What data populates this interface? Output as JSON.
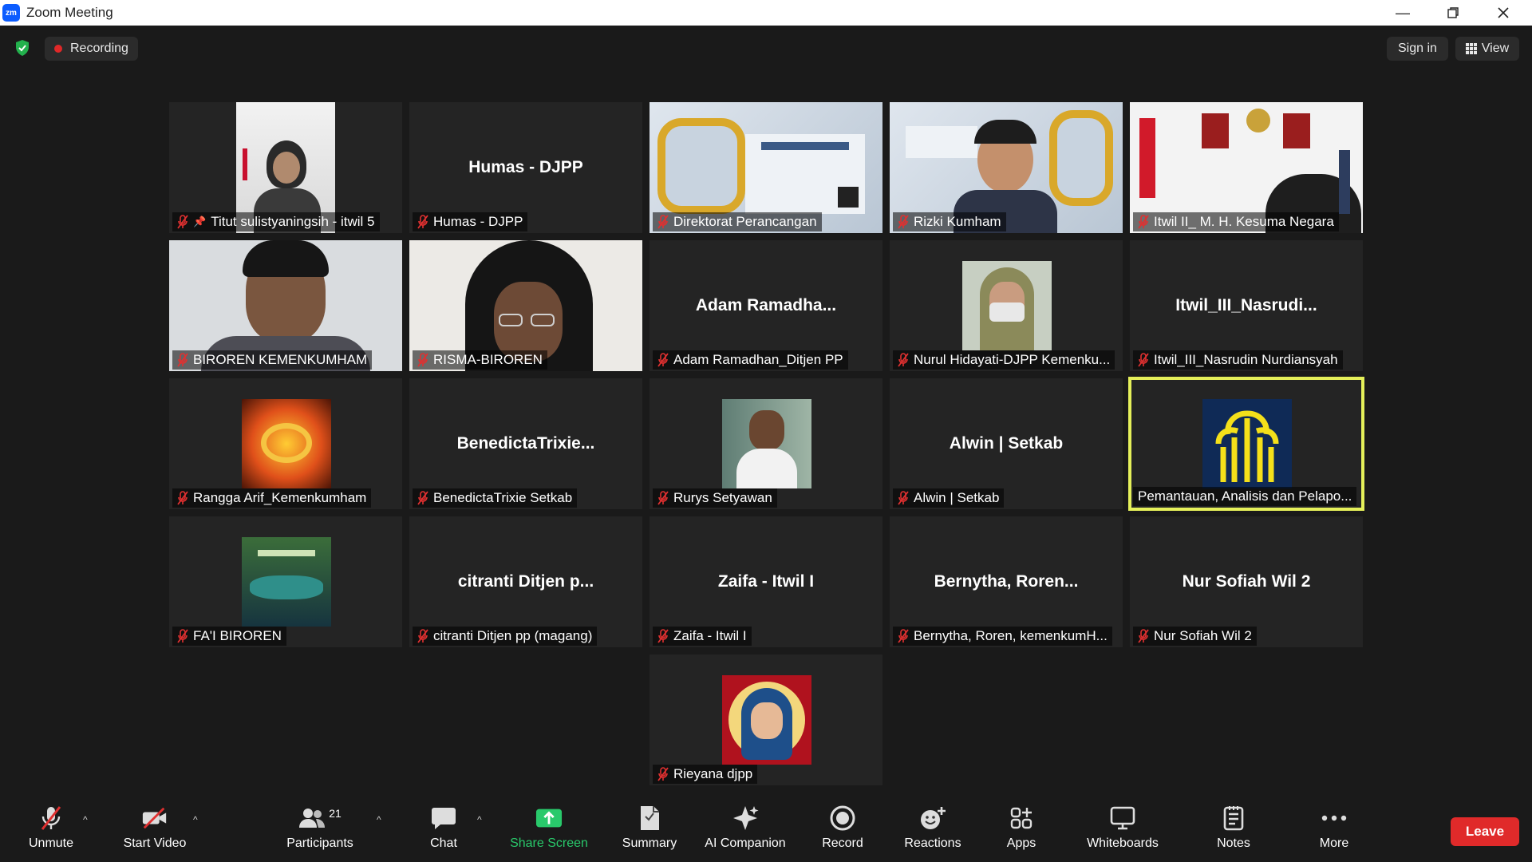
{
  "window": {
    "title": "Zoom Meeting"
  },
  "topbar": {
    "recording_label": "Recording",
    "signin_label": "Sign in",
    "view_label": "View"
  },
  "tiles": [
    {
      "name": "Titut sulistyaningsih - itwil 5",
      "bigname": "",
      "pinned": true
    },
    {
      "name": "Humas - DJPP",
      "bigname": "Humas - DJPP"
    },
    {
      "name": "Direktorat Perancangan",
      "bigname": ""
    },
    {
      "name": "Rizki Kumham",
      "bigname": ""
    },
    {
      "name": "Itwil II_ M. H. Kesuma Negara",
      "bigname": ""
    },
    {
      "name": "BIROREN KEMENKUMHAM",
      "bigname": ""
    },
    {
      "name": "RISMA-BIROREN",
      "bigname": ""
    },
    {
      "name": "Adam Ramadhan_Ditjen PP",
      "bigname": "Adam  Ramadha..."
    },
    {
      "name": "Nurul Hidayati-DJPP Kemenku...",
      "bigname": ""
    },
    {
      "name": "Itwil_III_Nasrudin Nurdiansyah",
      "bigname": "Itwil_III_Nasrudi..."
    },
    {
      "name": "Rangga Arif_Kemenkumham",
      "bigname": ""
    },
    {
      "name": "BenedictaTrixie Setkab",
      "bigname": "BenedictaTrixie..."
    },
    {
      "name": "Rurys Setyawan",
      "bigname": ""
    },
    {
      "name": "Alwin | Setkab",
      "bigname": "Alwin | Setkab"
    },
    {
      "name": "Pemantauan, Analisis dan Pelapo...",
      "bigname": ""
    },
    {
      "name": "FA'I BIROREN",
      "bigname": ""
    },
    {
      "name": "citranti Ditjen pp (magang)",
      "bigname": "citranti  Ditjen  p..."
    },
    {
      "name": "Zaifa - Itwil I",
      "bigname": "Zaifa - Itwil I"
    },
    {
      "name": "Bernytha, Roren, kemenkumH...",
      "bigname": "Bernytha,  Roren..."
    },
    {
      "name": "Nur Sofiah Wil 2",
      "bigname": "Nur Sofiah Wil 2"
    },
    {
      "name": "Rieyana djpp",
      "bigname": ""
    }
  ],
  "toolbar": {
    "unmute": "Unmute",
    "start_video": "Start Video",
    "participants": "Participants",
    "participants_count": "21",
    "chat": "Chat",
    "share_screen": "Share Screen",
    "summary": "Summary",
    "ai_companion": "AI Companion",
    "record": "Record",
    "reactions": "Reactions",
    "apps": "Apps",
    "whiteboards": "Whiteboards",
    "notes": "Notes",
    "more": "More",
    "leave": "Leave"
  },
  "colors": {
    "accent_green": "#29c96b",
    "leave_red": "#e02a2a",
    "active_speaker": "#e5f05a"
  }
}
